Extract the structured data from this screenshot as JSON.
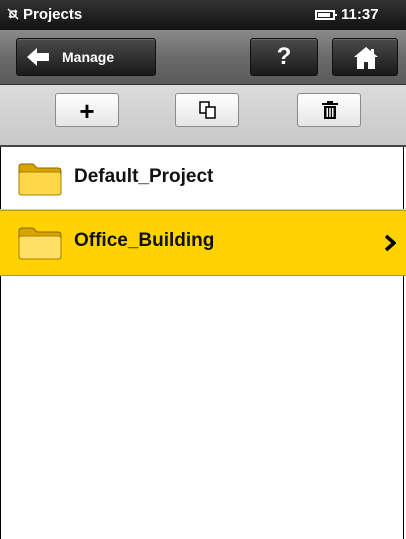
{
  "status_bar": {
    "app_icon": "satellite-icon",
    "title": "Projects",
    "battery_icon": "battery-icon",
    "time": "11:37"
  },
  "nav": {
    "back_label": "Manage",
    "back_icon": "arrow-left-icon",
    "help_label": "?",
    "home_icon": "home-icon"
  },
  "toolbar": {
    "add_label": "+",
    "copy_icon": "copy-icon",
    "delete_icon": "trash-icon"
  },
  "projects": [
    {
      "name": "Default_Project",
      "icon": "folder-icon",
      "selected": false
    },
    {
      "name": "Office_Building",
      "icon": "folder-icon",
      "selected": true
    }
  ],
  "colors": {
    "selection": "#ffd200",
    "folder": "#f5c300"
  }
}
